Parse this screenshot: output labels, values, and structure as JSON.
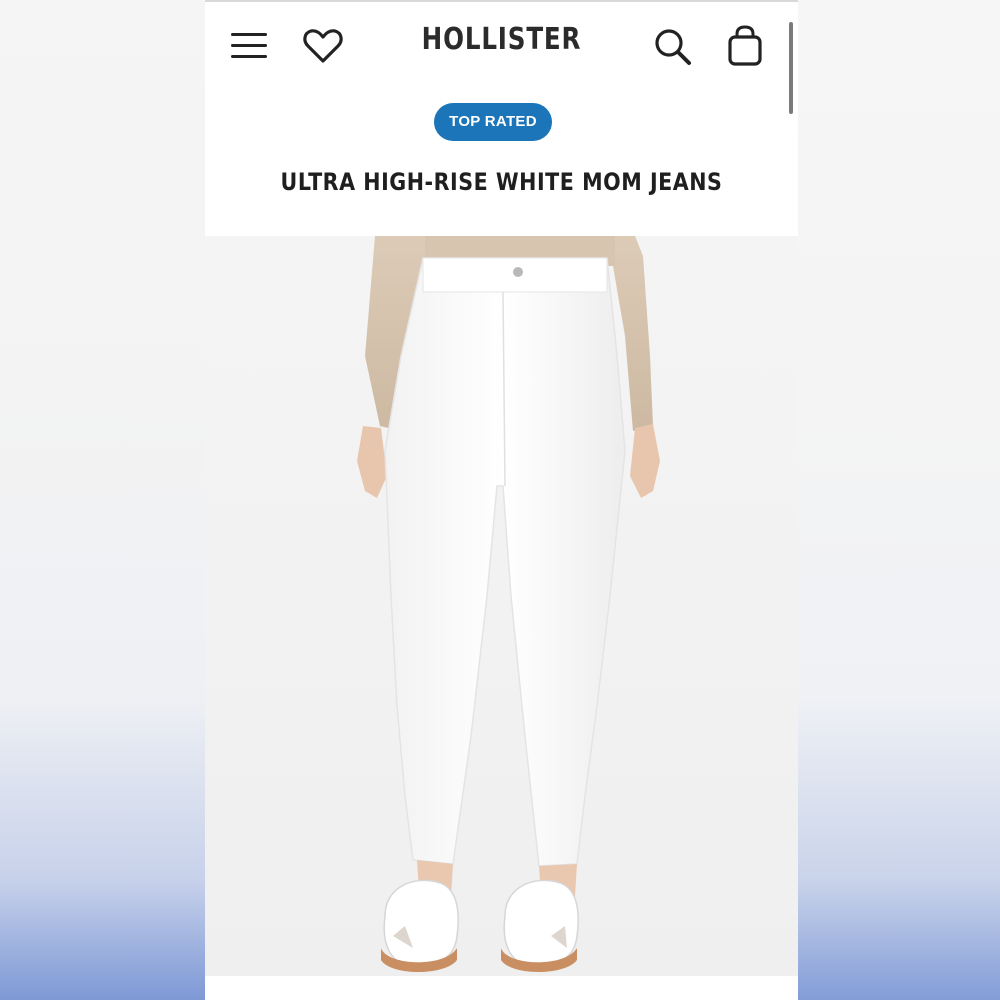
{
  "header": {
    "brand": "HOLLISTER",
    "icons": {
      "menu": "hamburger-menu-icon",
      "wishlist": "heart-icon",
      "search": "search-icon",
      "bag": "shopping-bag-icon"
    }
  },
  "product": {
    "badge": "TOP RATED",
    "title": "ULTRA HIGH-RISE WHITE MOM JEANS",
    "image_subject": "model-white-mom-jeans"
  },
  "colors": {
    "badge_bg": "#1b75b8",
    "text_dark": "#1f1f1f"
  }
}
